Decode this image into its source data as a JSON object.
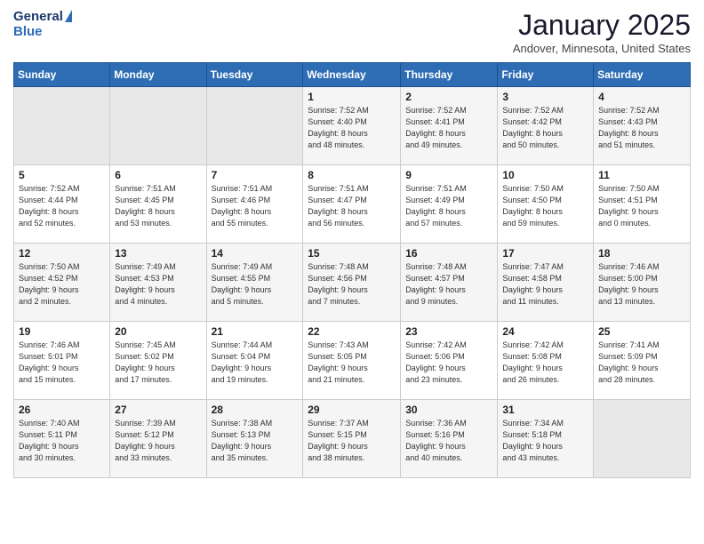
{
  "header": {
    "logo_general": "General",
    "logo_blue": "Blue",
    "month_title": "January 2025",
    "location": "Andover, Minnesota, United States"
  },
  "days_of_week": [
    "Sunday",
    "Monday",
    "Tuesday",
    "Wednesday",
    "Thursday",
    "Friday",
    "Saturday"
  ],
  "weeks": [
    [
      {
        "day": "",
        "info": ""
      },
      {
        "day": "",
        "info": ""
      },
      {
        "day": "",
        "info": ""
      },
      {
        "day": "1",
        "info": "Sunrise: 7:52 AM\nSunset: 4:40 PM\nDaylight: 8 hours\nand 48 minutes."
      },
      {
        "day": "2",
        "info": "Sunrise: 7:52 AM\nSunset: 4:41 PM\nDaylight: 8 hours\nand 49 minutes."
      },
      {
        "day": "3",
        "info": "Sunrise: 7:52 AM\nSunset: 4:42 PM\nDaylight: 8 hours\nand 50 minutes."
      },
      {
        "day": "4",
        "info": "Sunrise: 7:52 AM\nSunset: 4:43 PM\nDaylight: 8 hours\nand 51 minutes."
      }
    ],
    [
      {
        "day": "5",
        "info": "Sunrise: 7:52 AM\nSunset: 4:44 PM\nDaylight: 8 hours\nand 52 minutes."
      },
      {
        "day": "6",
        "info": "Sunrise: 7:51 AM\nSunset: 4:45 PM\nDaylight: 8 hours\nand 53 minutes."
      },
      {
        "day": "7",
        "info": "Sunrise: 7:51 AM\nSunset: 4:46 PM\nDaylight: 8 hours\nand 55 minutes."
      },
      {
        "day": "8",
        "info": "Sunrise: 7:51 AM\nSunset: 4:47 PM\nDaylight: 8 hours\nand 56 minutes."
      },
      {
        "day": "9",
        "info": "Sunrise: 7:51 AM\nSunset: 4:49 PM\nDaylight: 8 hours\nand 57 minutes."
      },
      {
        "day": "10",
        "info": "Sunrise: 7:50 AM\nSunset: 4:50 PM\nDaylight: 8 hours\nand 59 minutes."
      },
      {
        "day": "11",
        "info": "Sunrise: 7:50 AM\nSunset: 4:51 PM\nDaylight: 9 hours\nand 0 minutes."
      }
    ],
    [
      {
        "day": "12",
        "info": "Sunrise: 7:50 AM\nSunset: 4:52 PM\nDaylight: 9 hours\nand 2 minutes."
      },
      {
        "day": "13",
        "info": "Sunrise: 7:49 AM\nSunset: 4:53 PM\nDaylight: 9 hours\nand 4 minutes."
      },
      {
        "day": "14",
        "info": "Sunrise: 7:49 AM\nSunset: 4:55 PM\nDaylight: 9 hours\nand 5 minutes."
      },
      {
        "day": "15",
        "info": "Sunrise: 7:48 AM\nSunset: 4:56 PM\nDaylight: 9 hours\nand 7 minutes."
      },
      {
        "day": "16",
        "info": "Sunrise: 7:48 AM\nSunset: 4:57 PM\nDaylight: 9 hours\nand 9 minutes."
      },
      {
        "day": "17",
        "info": "Sunrise: 7:47 AM\nSunset: 4:58 PM\nDaylight: 9 hours\nand 11 minutes."
      },
      {
        "day": "18",
        "info": "Sunrise: 7:46 AM\nSunset: 5:00 PM\nDaylight: 9 hours\nand 13 minutes."
      }
    ],
    [
      {
        "day": "19",
        "info": "Sunrise: 7:46 AM\nSunset: 5:01 PM\nDaylight: 9 hours\nand 15 minutes."
      },
      {
        "day": "20",
        "info": "Sunrise: 7:45 AM\nSunset: 5:02 PM\nDaylight: 9 hours\nand 17 minutes."
      },
      {
        "day": "21",
        "info": "Sunrise: 7:44 AM\nSunset: 5:04 PM\nDaylight: 9 hours\nand 19 minutes."
      },
      {
        "day": "22",
        "info": "Sunrise: 7:43 AM\nSunset: 5:05 PM\nDaylight: 9 hours\nand 21 minutes."
      },
      {
        "day": "23",
        "info": "Sunrise: 7:42 AM\nSunset: 5:06 PM\nDaylight: 9 hours\nand 23 minutes."
      },
      {
        "day": "24",
        "info": "Sunrise: 7:42 AM\nSunset: 5:08 PM\nDaylight: 9 hours\nand 26 minutes."
      },
      {
        "day": "25",
        "info": "Sunrise: 7:41 AM\nSunset: 5:09 PM\nDaylight: 9 hours\nand 28 minutes."
      }
    ],
    [
      {
        "day": "26",
        "info": "Sunrise: 7:40 AM\nSunset: 5:11 PM\nDaylight: 9 hours\nand 30 minutes."
      },
      {
        "day": "27",
        "info": "Sunrise: 7:39 AM\nSunset: 5:12 PM\nDaylight: 9 hours\nand 33 minutes."
      },
      {
        "day": "28",
        "info": "Sunrise: 7:38 AM\nSunset: 5:13 PM\nDaylight: 9 hours\nand 35 minutes."
      },
      {
        "day": "29",
        "info": "Sunrise: 7:37 AM\nSunset: 5:15 PM\nDaylight: 9 hours\nand 38 minutes."
      },
      {
        "day": "30",
        "info": "Sunrise: 7:36 AM\nSunset: 5:16 PM\nDaylight: 9 hours\nand 40 minutes."
      },
      {
        "day": "31",
        "info": "Sunrise: 7:34 AM\nSunset: 5:18 PM\nDaylight: 9 hours\nand 43 minutes."
      },
      {
        "day": "",
        "info": ""
      }
    ]
  ]
}
